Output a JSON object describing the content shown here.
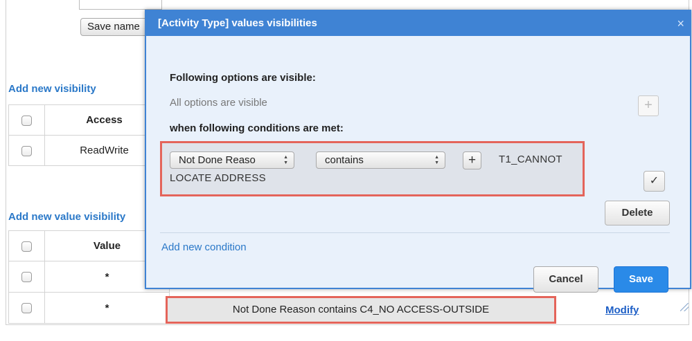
{
  "background": {
    "save_name_label": "Save name",
    "add_visibility_link": "Add new visibility",
    "visibility_table": {
      "headers": [
        "",
        "Access"
      ],
      "rows": [
        {
          "checked": false,
          "access": "ReadWrite"
        }
      ]
    },
    "add_value_visibility_link": "Add new value visibility",
    "value_table": {
      "headers": [
        "",
        "Value"
      ],
      "rows": [
        {
          "checked": false,
          "value": "*"
        },
        {
          "checked": false,
          "value": "*",
          "condition": "Not Done Reason contains C4_NO ACCESS-OUTSIDE",
          "action": "Modify"
        }
      ]
    }
  },
  "modal": {
    "title": "[Activity Type] values visibilities",
    "close_glyph": "×",
    "options_heading": "Following options are visible:",
    "options_status": "All options are visible",
    "add_option_glyph": "+",
    "conditions_heading": "when following conditions are met:",
    "condition": {
      "field": "Not Done Reaso",
      "operator": "contains",
      "add_glyph": "+",
      "value_line1": "T1_CANNOT",
      "value_line2": "LOCATE ADDRESS"
    },
    "confirm_glyph": "✓",
    "delete_label": "Delete",
    "add_condition_link": "Add new condition",
    "cancel_label": "Cancel",
    "save_label": "Save"
  },
  "colors": {
    "modal_header": "#3f83d4",
    "modal_body": "#e9f1fb",
    "highlight_border": "#e4645a",
    "link": "#2a78c8",
    "primary_button": "#2a8ae8"
  }
}
